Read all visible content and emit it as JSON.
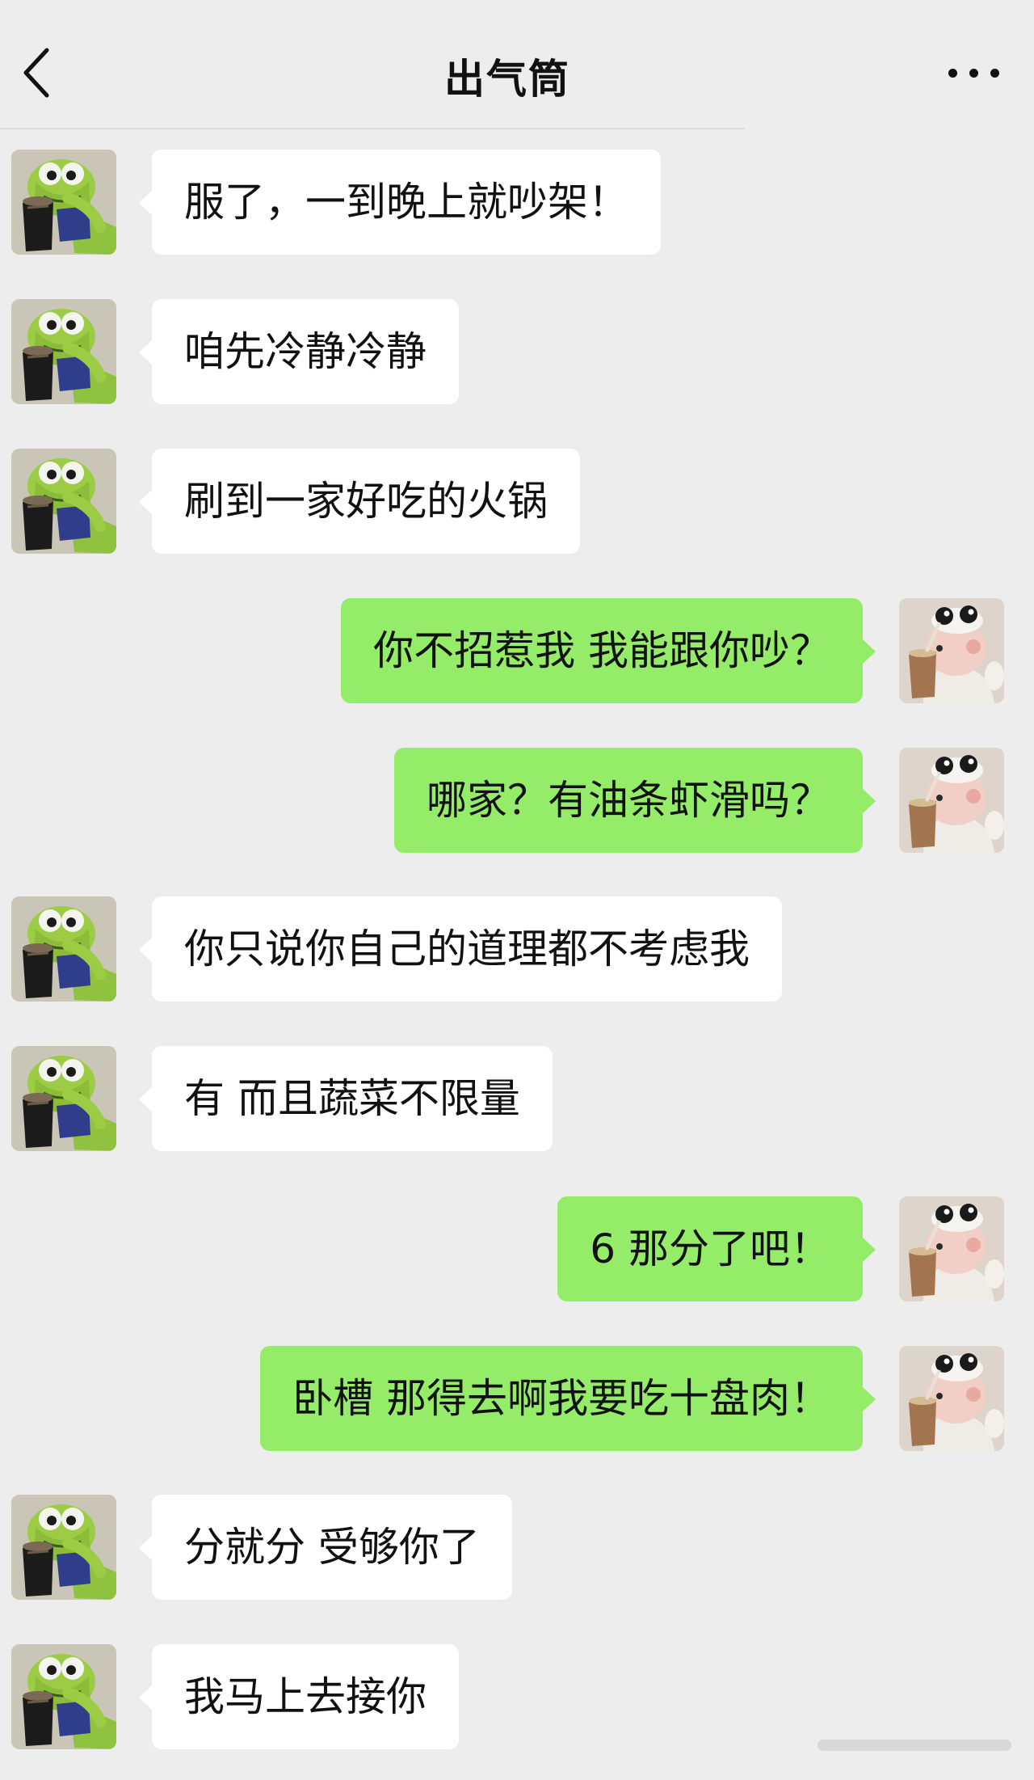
{
  "header": {
    "title": "出气筒",
    "back_icon": "chevron-left-icon",
    "more_icon": "more-dots-icon"
  },
  "colors": {
    "background": "#ededed",
    "sent_bubble": "#95ec69",
    "received_bubble": "#ffffff"
  },
  "messages": [
    {
      "side": "left",
      "text": "服了，一到晚上就吵架！"
    },
    {
      "side": "left",
      "text": "咱先冷静冷静"
    },
    {
      "side": "left",
      "text": "刷到一家好吃的火锅"
    },
    {
      "side": "right",
      "text": "你不招惹我 我能跟你吵？"
    },
    {
      "side": "right",
      "text": "哪家？有油条虾滑吗？"
    },
    {
      "side": "left",
      "text": "你只说你自己的道理都不考虑我"
    },
    {
      "side": "left",
      "text": "有 而且蔬菜不限量"
    },
    {
      "side": "right",
      "text": "6 那分了吧！"
    },
    {
      "side": "right",
      "text": "卧槽 那得去啊我要吃十盘肉！"
    },
    {
      "side": "left",
      "text": "分就分 受够你了"
    },
    {
      "side": "left",
      "text": "我马上去接你"
    }
  ]
}
